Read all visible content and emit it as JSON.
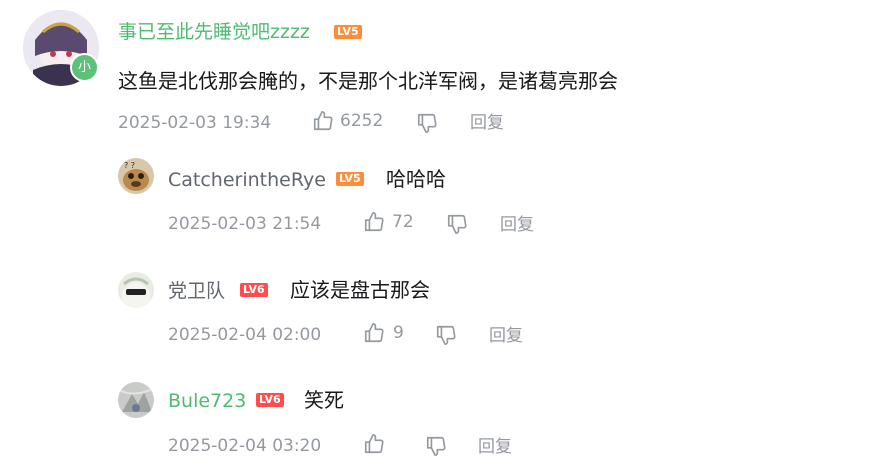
{
  "comments": [
    {
      "username": "事已至此先睡觉吧zzzz",
      "level": "LV5",
      "username_color": "#4fbb6f",
      "badge_text": "小",
      "content": "这鱼是北伐那会腌的，不是那个北洋军阀，是诸葛亮那会",
      "time": "2025-02-03 19:34",
      "likes": "6252",
      "reply_label": "回复"
    },
    {
      "username": "CatcherintheRye",
      "level": "LV5",
      "content": "哈哈哈",
      "time": "2025-02-03 21:54",
      "likes": "72",
      "reply_label": "回复"
    },
    {
      "username": "党卫队",
      "level": "LV6",
      "content": "应该是盘古那会",
      "time": "2025-02-04 02:00",
      "likes": "9",
      "reply_label": "回复"
    },
    {
      "username": "Bule723",
      "level": "LV6",
      "username_color": "#4fbb6f",
      "content": "笑死",
      "time": "2025-02-04 03:20",
      "likes": "",
      "reply_label": "回复"
    }
  ],
  "icons": {
    "like": "thumbs-up-icon",
    "dislike": "thumbs-down-icon"
  },
  "colors": {
    "lv5": "#ff8c3a",
    "lv6": "#ff4d4d",
    "meta_text": "#9499a0",
    "vip_name": "#4fbb6f"
  }
}
